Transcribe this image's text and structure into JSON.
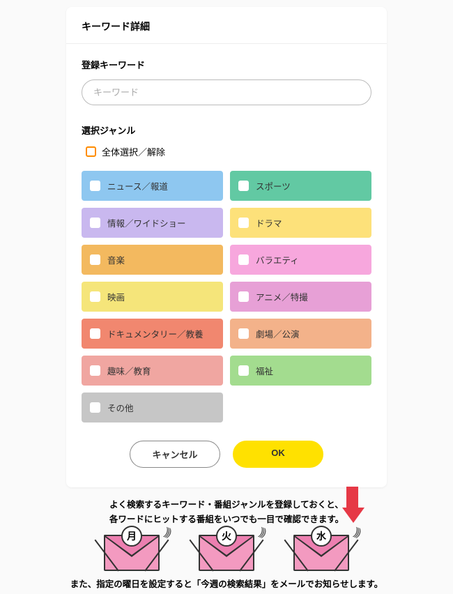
{
  "card": {
    "title": "キーワード詳細",
    "keyword_label": "登録キーワード",
    "keyword_placeholder": "キーワード",
    "genre_label": "選択ジャンル",
    "select_all_label": "全体選択／解除",
    "genres": [
      {
        "label": "ニュース／報道",
        "color": "#8ec7f0"
      },
      {
        "label": "スポーツ",
        "color": "#62c9a3"
      },
      {
        "label": "情報／ワイドショー",
        "color": "#c9b8ef"
      },
      {
        "label": "ドラマ",
        "color": "#fde17a"
      },
      {
        "label": "音楽",
        "color": "#f3b95f"
      },
      {
        "label": "バラエティ",
        "color": "#f7a7dd"
      },
      {
        "label": "映画",
        "color": "#f5e57a"
      },
      {
        "label": "アニメ／特撮",
        "color": "#e7a0d6"
      },
      {
        "label": "ドキュメンタリー／教養",
        "color": "#f1876f"
      },
      {
        "label": "劇場／公演",
        "color": "#f3b28a"
      },
      {
        "label": "趣味／教育",
        "color": "#f0a6a1"
      },
      {
        "label": "福祉",
        "color": "#a3dc8f"
      },
      {
        "label": "その他",
        "color": "#c6c6c6"
      }
    ],
    "cancel_label": "キャンセル",
    "ok_label": "OK"
  },
  "info": {
    "line1": "よく検索するキーワード・番組ジャンルを登録しておくと、",
    "line2": "各ワードにヒットする番組をいつでも一目で確認できます。",
    "days": [
      "月",
      "火",
      "水"
    ],
    "footer": "また、指定の曜日を設定すると「今週の検索結果」をメールでお知らせします。"
  }
}
